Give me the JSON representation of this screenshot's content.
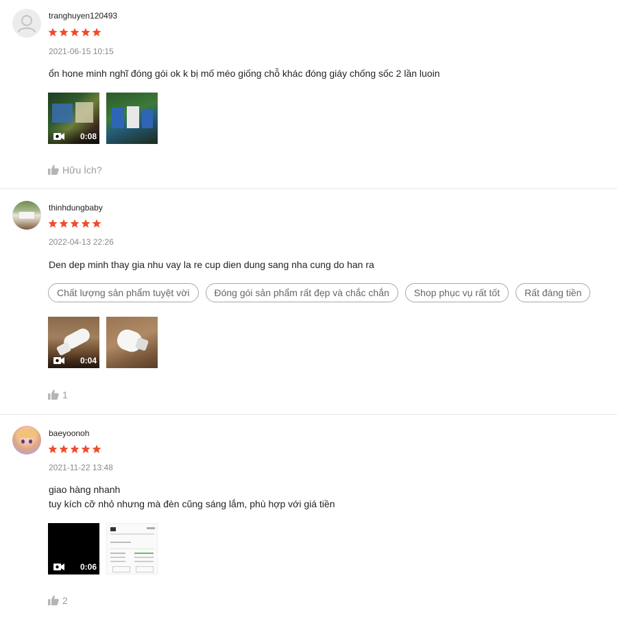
{
  "colors": {
    "star": "#ee4d2d",
    "divider": "#e6e6e6",
    "muted": "#8a8a8a"
  },
  "reviews": [
    {
      "username": "tranghuyen120493",
      "rating": 5,
      "date": "2021-06-15 10:15",
      "comment": [
        "ổn hone minh nghĩ đóng gói ok k bị mố méo giống chỗ khác đóng giáy chống sốc 2 lần luoin"
      ],
      "tags": [],
      "video_duration": "0:08",
      "like_label": "Hữu Ích?"
    },
    {
      "username": "thinhdungbaby",
      "rating": 5,
      "date": "2022-04-13 22:26",
      "comment": [
        "Den dep minh thay gia nhu vay la re cup dien dung sang nha cung do han ra"
      ],
      "tags": [
        "Chất lượng sản phẩm tuyệt vời",
        "Đóng gói sản phẩm rất đẹp và chắc chắn",
        "Shop phục vụ rất tốt",
        "Rất đáng tiền"
      ],
      "video_duration": "0:04",
      "like_label": "1"
    },
    {
      "username": "baeyoonoh",
      "rating": 5,
      "date": "2021-11-22 13:48",
      "comment": [
        "giao hàng nhanh",
        "tuy kích cỡ nhỏ nhưng mà đèn cũng sáng lắm, phù hợp với giá tiền"
      ],
      "tags": [],
      "video_duration": "0:06",
      "like_label": "2"
    }
  ]
}
